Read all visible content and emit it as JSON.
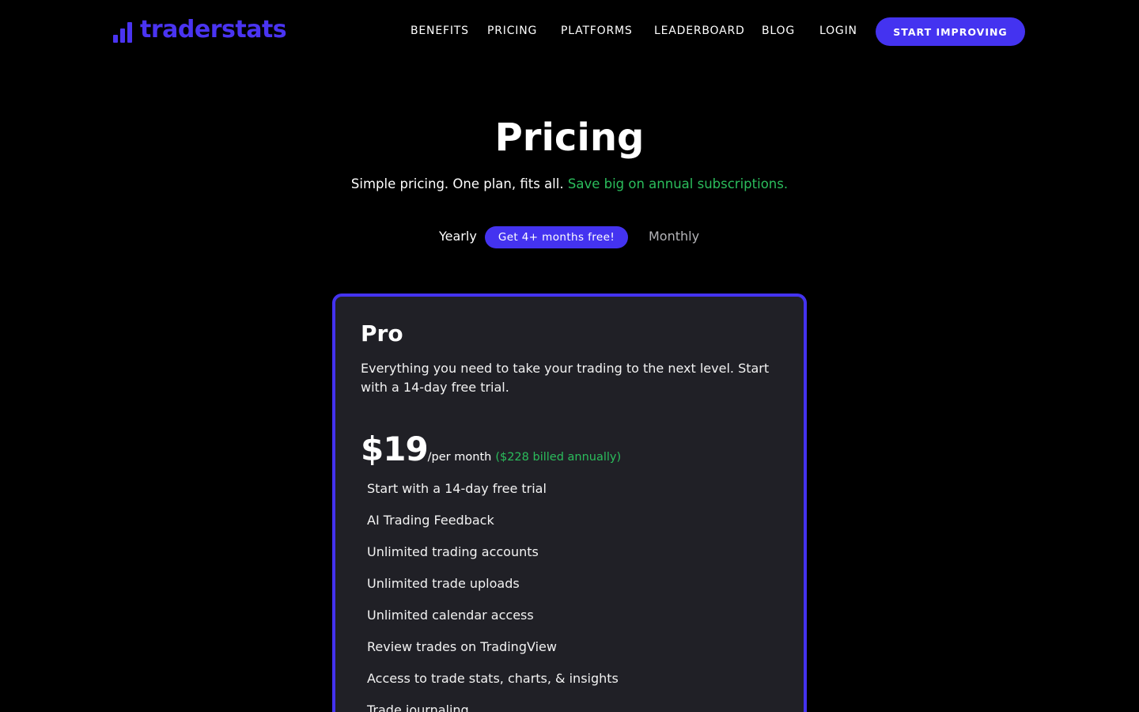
{
  "header": {
    "logo_text": "traderstats",
    "nav": [
      "BENEFITS",
      "PRICING",
      "PLATFORMS",
      "LEADERBOARD",
      "BLOG",
      "LOGIN"
    ],
    "cta_label": "START IMPROVING"
  },
  "hero": {
    "title": "Pricing",
    "subtitle": "Simple pricing. One plan, fits all.",
    "subtitle_highlight": "Save big on annual subscriptions."
  },
  "billing_toggle": {
    "yearly_label": "Yearly",
    "badge": "Get 4+ months free!",
    "monthly_label": "Monthly",
    "selected": "Yearly"
  },
  "plan": {
    "name": "Pro",
    "description": "Everything you need to take your trading to the next level. Start with a 14-day free trial.",
    "price": "$19",
    "period": "/per month",
    "billed_note": "($228 billed annually)",
    "features": [
      "Start with a 14-day free trial",
      "AI Trading Feedback",
      "Unlimited trading accounts",
      "Unlimited trade uploads",
      "Unlimited calendar access",
      "Review trades on TradingView",
      "Access to trade stats, charts, & insights",
      "Trade journaling"
    ]
  },
  "colors": {
    "background": "#000000",
    "accent": "#4433f0",
    "logo": "#4a34f2",
    "highlight_green": "#2bbd5c",
    "card_background": "#202026"
  }
}
